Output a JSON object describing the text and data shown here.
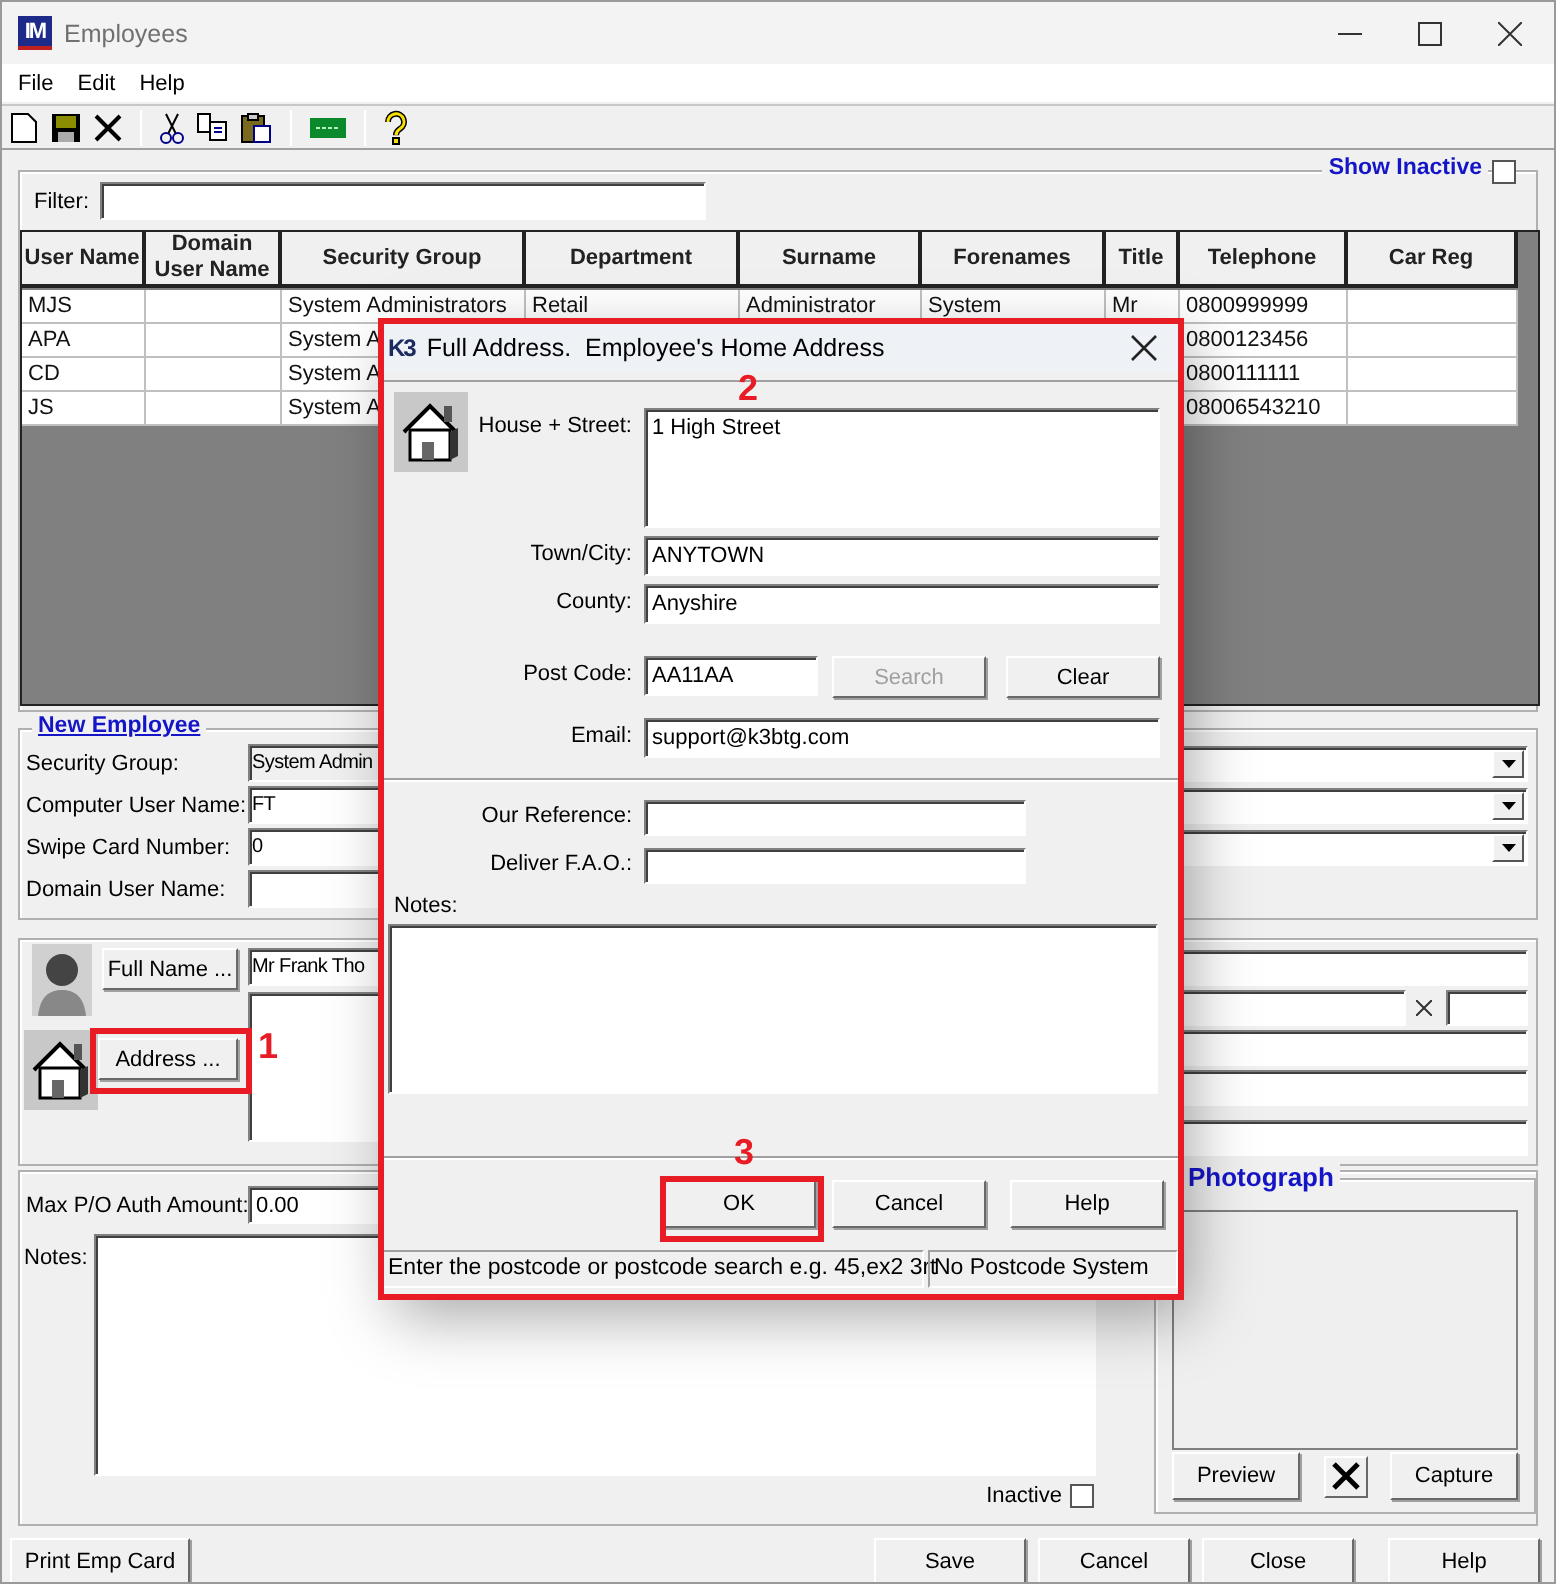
{
  "window": {
    "logo": "IM",
    "title": "Employees"
  },
  "menu": [
    "File",
    "Edit",
    "Help"
  ],
  "show_inactive": {
    "label": "Show Inactive",
    "checked": false
  },
  "filter": {
    "label": "Filter:"
  },
  "table": {
    "columns": [
      "User Name",
      "Domain User Name",
      "Security Group",
      "Department",
      "Surname",
      "Forenames",
      "Title",
      "Telephone",
      "Car Reg"
    ],
    "rows": [
      [
        "MJS",
        null,
        "System Administrators",
        "Retail",
        "Administrator",
        "System",
        "Mr",
        "0800999999",
        null
      ],
      [
        "APA",
        null,
        "System A",
        null,
        null,
        null,
        null,
        "0800123456",
        null
      ],
      [
        "CD",
        null,
        "System A",
        null,
        null,
        null,
        null,
        "0800111111",
        null
      ],
      [
        "JS",
        null,
        "System A",
        null,
        null,
        null,
        null,
        "08006543210",
        null
      ]
    ]
  },
  "new_employee": {
    "legend": "New Employee",
    "fields": [
      {
        "label": "Security Group:",
        "value": "System Admin",
        "kind": "readonly"
      },
      {
        "label": "Computer User Name:",
        "value": "FT",
        "kind": "text"
      },
      {
        "label": "Swipe Card Number:",
        "value": "0",
        "kind": "text"
      },
      {
        "label": "Domain User Name:",
        "kind": "text"
      }
    ]
  },
  "name_section": {
    "full_name_button": "Full Name ...",
    "full_name": "Mr Frank Tho",
    "address_button": "Address ..."
  },
  "details": {
    "amount_label": "Max P/O Auth Amount:",
    "amount": "0.00",
    "notes_label": "Notes:",
    "inactive": {
      "label": "Inactive",
      "checked": false
    }
  },
  "photograph": {
    "legend": "Photograph",
    "buttons": [
      "Preview",
      "Capture"
    ]
  },
  "print_button": "Print Emp Card",
  "buttons": [
    "Save",
    "Cancel",
    "Close",
    "Help"
  ],
  "dialog": {
    "logo": "K3",
    "title": "Full Address.  Employee's Home Address",
    "sections": [
      [
        {
          "kind": "multiline",
          "label": "House + Street:",
          "value": "1 High Street"
        },
        {
          "kind": "line",
          "label": "Town/City:",
          "value": "ANYTOWN"
        },
        {
          "kind": "line",
          "label": "County:",
          "value": "Anyshire"
        },
        {
          "kind": "postcode",
          "label": "Post Code:",
          "value": "AA11AA",
          "buttons": [
            {
              "label": "Search",
              "disabled": true
            },
            {
              "label": "Clear",
              "disabled": false
            }
          ]
        },
        {
          "kind": "line",
          "label": "Email:",
          "value": "support@k3btg.com"
        }
      ],
      [
        {
          "kind": "short",
          "label": "Our Reference:"
        },
        {
          "kind": "short",
          "label": "Deliver F.A.O.:"
        }
      ]
    ],
    "notes_label": "Notes:",
    "buttons": [
      "OK",
      "Cancel",
      "Help"
    ],
    "status": [
      "Enter the postcode or postcode search e.g. 45,ex2 3rt",
      "No Postcode System"
    ]
  },
  "annotations": [
    {
      "label": "1"
    },
    {
      "label": "2"
    },
    {
      "label": "3"
    }
  ]
}
